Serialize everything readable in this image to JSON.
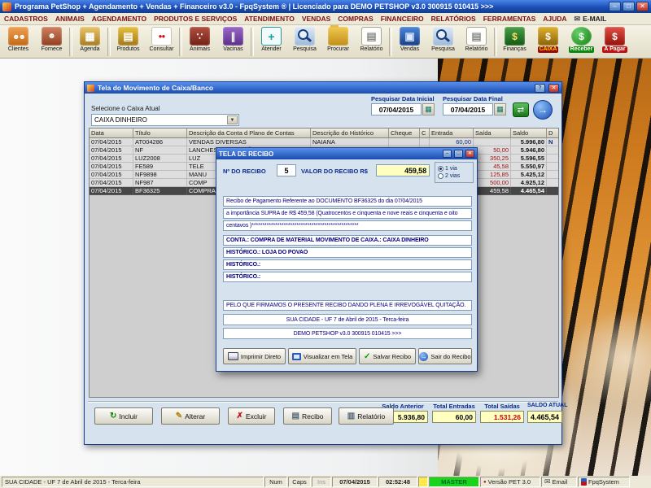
{
  "title_bar": {
    "title": "Programa PetShop + Agendamento + Vendas + Financeiro v3.0 - FpqSystem ® | Licenciado para  DEMO PETSHOP v3.0 300915 010415 >>>"
  },
  "menu": {
    "items": [
      "CADASTROS",
      "ANIMAIS",
      "AGENDAMENTO",
      "PRODUTOS E SERVIÇOS",
      "ATENDIMENTO",
      "VENDAS",
      "COMPRAS",
      "FINANCEIRO",
      "RELATÓRIOS",
      "FERRAMENTAS",
      "AJUDA"
    ],
    "email_label": "E-MAIL"
  },
  "toolbar": {
    "buttons": [
      {
        "label": "Clientes",
        "icon": "clients-icon"
      },
      {
        "label": "Fornece",
        "icon": "supplier-icon"
      },
      {
        "label": "Agenda",
        "icon": "agenda-icon"
      },
      {
        "label": "Produtos",
        "icon": "products-icon"
      },
      {
        "label": "Consultar",
        "icon": "consult-icon"
      },
      {
        "label": "Animais",
        "icon": "animals-icon"
      },
      {
        "label": "Vacinas",
        "icon": "vaccines-icon"
      },
      {
        "label": "Atender",
        "icon": "attend-icon"
      },
      {
        "label": "Pesquisa",
        "icon": "search-icon"
      },
      {
        "label": "Procurar",
        "icon": "folder-search-icon"
      },
      {
        "label": "Relatório",
        "icon": "report-icon"
      },
      {
        "label": "Vendas",
        "icon": "sales-icon"
      },
      {
        "label": "Pesquisa",
        "icon": "search-icon"
      },
      {
        "label": "Relatório",
        "icon": "report-icon"
      },
      {
        "label": "Finanças",
        "icon": "finance-icon"
      },
      {
        "label": "CAIXA",
        "icon": "cashbox-icon",
        "chip": {
          "bg": "#9a0a0a",
          "fg": "#ffd700"
        }
      },
      {
        "label": "Receber",
        "icon": "receive-icon",
        "chip": {
          "bg": "#0a8a0a",
          "fg": "#ffffff"
        }
      },
      {
        "label": "A Pagar",
        "icon": "pay-icon",
        "chip": {
          "bg": "#c01010",
          "fg": "#ffffff"
        }
      }
    ]
  },
  "window": {
    "title": "Tela do Movimento de Caixa/Banco",
    "caixa_label": "Selecione o Caixa Atual",
    "caixa_value": "CAIXA DINHEIRO",
    "data_inicial_label": "Pesquisar Data Inicial",
    "data_inicial": "07/04/2015",
    "data_final_label": "Pesquisar Data Final",
    "data_final": "07/04/2015",
    "table": {
      "headers": [
        "Data",
        "Título",
        "Descrição da Conta d Plano de Contas",
        "Descrição do Histórico",
        "Cheque",
        "C",
        "Entrada",
        "Saída",
        "Saldo",
        "D"
      ],
      "selected_index": 6,
      "rows": [
        [
          "07/04/2015",
          "AT004286",
          "VENDAS DIVERSAS",
          "NAIANA",
          "",
          "",
          "60,00",
          "",
          "5.996,80",
          "N"
        ],
        [
          "07/04/2015",
          "NF",
          "LANCHES E REFEIÇÕES",
          "",
          "",
          "",
          "",
          "50,00",
          "5.946,80",
          ""
        ],
        [
          "07/04/2015",
          "LUZ2008",
          "LUZ",
          "",
          "",
          "",
          "",
          "350,25",
          "5.596,55",
          ""
        ],
        [
          "07/04/2015",
          "FE589",
          "TELE",
          "",
          "",
          "",
          "",
          "45,58",
          "5.550,97",
          ""
        ],
        [
          "07/04/2015",
          "NF9898",
          "MANU",
          "",
          "",
          "",
          "",
          "125,85",
          "5.425,12",
          ""
        ],
        [
          "07/04/2015",
          "NF987",
          "COMP",
          "",
          "",
          "",
          "",
          "500,00",
          "4.925,12",
          ""
        ],
        [
          "07/04/2015",
          "BF36325",
          "COMPRA DE MATERIAL",
          "",
          "",
          "",
          "",
          "459,58",
          "4.465,54",
          ""
        ]
      ]
    },
    "buttons": [
      {
        "label": "Incluir",
        "icon": "incluir-icon"
      },
      {
        "label": "Alterar",
        "icon": "alterar-icon"
      },
      {
        "label": "Excluir",
        "icon": "excluir-icon"
      },
      {
        "label": "Recibo",
        "icon": "recibo-icon"
      },
      {
        "label": "Relatório",
        "icon": "relatorio-icon"
      }
    ],
    "summary": {
      "saldo_anterior_label": "Saldo Anterior",
      "saldo_anterior": "5.936,80",
      "total_entradas_label": "Total Entradas",
      "total_entradas": "60,00",
      "total_saidas_label": "Total Saídas",
      "total_saidas": "1.531,26",
      "saldo_atual_label": "SALDO ATUAL",
      "saldo_atual": "4.465,54"
    }
  },
  "modal": {
    "title": "TELA DE RECIBO",
    "numero_label": "Nº DO RECIBO",
    "numero": "5",
    "valor_label": "VALOR DO RECIBO R$",
    "valor": "459,58",
    "via1": "1 via",
    "via2": "2 vias",
    "linha1": "Recibo de Pagamento Referente ao DOCUMENTO BF36325  do dia 07/04/2015",
    "linha2": "a importância SUPRA de R$    459,58 (Quatrocentos e cinquenta e nove reais e cinquenta e oito",
    "linha3": "centavos )**************************************************",
    "conta": "CONTA.: COMPRA DE MATERIAL   MOVIMENTO DE CAIXA.: CAIXA DINHEIRO",
    "historico1": "HISTÓRICO.: LOJA DO POVAO",
    "historico2": "HISTÓRICO.:",
    "historico3": "HISTÓRICO.:",
    "quitacao": "PELO QUE FIRMAMOS O PRESENTE RECIBO DANDO PLENA E IRREVOGÁVEL QUITAÇÃO.",
    "cidade": "SUA CIDADE - UF  7 de Abril de 2015 - Terca-feira",
    "empresa": "DEMO PETSHOP v3.0 300915 010415 >>>",
    "buttons": [
      {
        "label": "Imprimir Direto",
        "icon": "printer-icon"
      },
      {
        "label": "Visualizar em Tela",
        "icon": "screen-icon"
      },
      {
        "label": "Salvar Recibo",
        "icon": "save-check-icon"
      },
      {
        "label": "Sair do Recibo",
        "icon": "exit-icon"
      }
    ]
  },
  "statusbar": {
    "segments": [
      {
        "name": "location",
        "text": "SUA CIDADE - UF  7 de Abril de 2015 - Terca-feira"
      },
      {
        "name": "num",
        "text": "Num"
      },
      {
        "name": "caps",
        "text": "Caps"
      },
      {
        "name": "ins",
        "text": "Ins"
      },
      {
        "name": "date",
        "text": "07/04/2015"
      },
      {
        "name": "time",
        "text": "02:52:48"
      },
      {
        "name": "accent",
        "text": ""
      },
      {
        "name": "master",
        "text": "MASTER"
      },
      {
        "name": "version",
        "text": "Versão PET 3.0"
      },
      {
        "name": "email",
        "text": "Email"
      },
      {
        "name": "brand",
        "text": "FpqSystem"
      }
    ]
  }
}
